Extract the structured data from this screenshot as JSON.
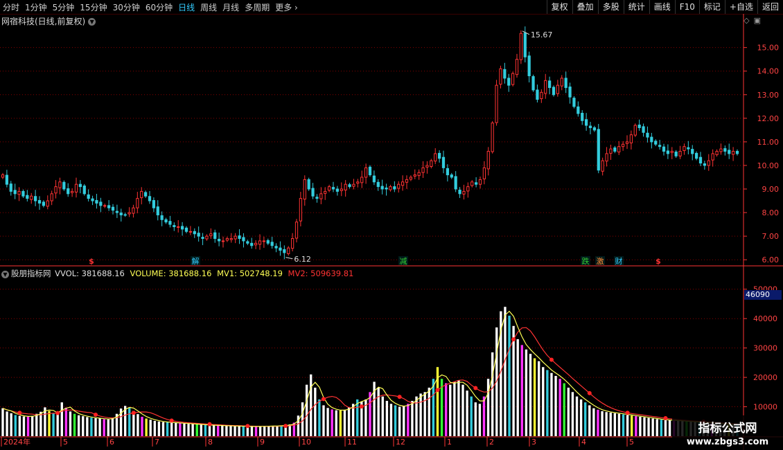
{
  "timeframes": [
    "分时",
    "1分钟",
    "5分钟",
    "15分钟",
    "30分钟",
    "60分钟",
    "日线",
    "周线",
    "月线",
    "多周期",
    "更多"
  ],
  "active_timeframe": "日线",
  "right_buttons": [
    "复权",
    "叠加",
    "多股",
    "统计",
    "画线",
    "F10",
    "标记",
    "+自选",
    "返回"
  ],
  "stock_title": "网宿科技(日线,前复权)",
  "corner_icons": [
    "diamond-icon",
    "window-icon"
  ],
  "indicator": {
    "name": "股朋指标网",
    "vvol": "VVOL: 381688.16",
    "volume": "VOLUME: 381688.16",
    "mv1": "MV1: 502748.19",
    "mv2": "MV2: 509639.81"
  },
  "colors": {
    "up": "#ff3333",
    "down": "#33ccdd",
    "mv1": "#ffff55",
    "mv2": "#ff3333",
    "grid": "#8a0000",
    "axis": "#ff3333"
  },
  "chart_data": [
    {
      "type": "candlestick",
      "price_axis": {
        "ticks": [
          "15.00",
          "14.00",
          "13.00",
          "12.00",
          "11.00",
          "10.00",
          "9.00",
          "8.00",
          "7.00",
          "6.00"
        ],
        "ylim": [
          5.8,
          15.9
        ]
      },
      "annotations": {
        "high": "15.67",
        "low": "6.12"
      },
      "event_markers": [
        "$",
        "解",
        "减",
        "跌",
        "激",
        "财",
        "$"
      ],
      "close_series": [
        9.6,
        9.2,
        8.9,
        8.8,
        8.9,
        8.7,
        8.6,
        8.7,
        8.5,
        8.4,
        8.3,
        8.5,
        8.8,
        9.1,
        9.3,
        9.0,
        8.8,
        8.9,
        9.2,
        9.1,
        8.8,
        8.6,
        8.5,
        8.4,
        8.3,
        8.3,
        8.2,
        8.1,
        8.0,
        7.9,
        7.9,
        8.0,
        8.2,
        8.6,
        8.9,
        8.7,
        8.5,
        8.2,
        7.9,
        7.7,
        7.6,
        7.5,
        7.4,
        7.4,
        7.3,
        7.2,
        7.2,
        7.1,
        7.0,
        6.9,
        7.0,
        7.1,
        6.9,
        6.8,
        6.8,
        6.9,
        6.9,
        7.0,
        6.9,
        6.8,
        6.7,
        6.6,
        6.7,
        6.8,
        6.8,
        6.7,
        6.6,
        6.5,
        6.4,
        6.3,
        6.5,
        6.9,
        7.6,
        8.6,
        9.4,
        9.0,
        8.7,
        8.6,
        8.8,
        8.9,
        9.1,
        9.0,
        8.9,
        9.0,
        9.2,
        9.1,
        9.2,
        9.3,
        9.5,
        9.9,
        9.6,
        9.3,
        9.1,
        9.0,
        9.0,
        9.1,
        9.0,
        9.2,
        9.3,
        9.4,
        9.5,
        9.6,
        9.7,
        9.9,
        10.0,
        10.2,
        10.5,
        10.3,
        9.9,
        9.6,
        9.5,
        9.0,
        8.8,
        8.9,
        9.1,
        9.3,
        9.2,
        9.4,
        9.9,
        10.6,
        11.8,
        13.4,
        14.1,
        13.7,
        13.4,
        13.9,
        14.5,
        15.6,
        14.6,
        13.8,
        13.2,
        12.8,
        13.1,
        13.6,
        13.3,
        13.0,
        13.4,
        13.7,
        13.3,
        12.9,
        12.5,
        12.2,
        11.9,
        11.7,
        11.6,
        11.5,
        9.8,
        10.2,
        10.5,
        10.7,
        10.6,
        10.8,
        10.9,
        11.0,
        11.3,
        11.7,
        11.6,
        11.4,
        11.2,
        11.0,
        10.9,
        10.8,
        10.6,
        10.5,
        10.6,
        10.4,
        10.6,
        10.8,
        10.7,
        10.5,
        10.3,
        10.1,
        10.0,
        10.2,
        10.5,
        10.6,
        10.7,
        10.6,
        10.5,
        10.6,
        10.5
      ]
    },
    {
      "type": "bar",
      "volume_axis": {
        "ticks": [
          "50000",
          "40000",
          "30000",
          "20000",
          "10000"
        ],
        "ylim": [
          0,
          53000
        ]
      },
      "badge": "46090",
      "month_labels": [
        "2024年",
        "5",
        "6",
        "7",
        "8",
        "9",
        "10",
        "11",
        "12",
        "1",
        "2",
        "3",
        "4",
        "5"
      ],
      "volume_series": [
        9500,
        8400,
        7800,
        7200,
        6900,
        6700,
        6600,
        6900,
        7600,
        8300,
        9800,
        8600,
        7800,
        7300,
        11500,
        9700,
        8400,
        7600,
        7100,
        6800,
        6500,
        6300,
        6100,
        6000,
        5800,
        5700,
        6300,
        7600,
        9400,
        10300,
        9700,
        8600,
        7500,
        6600,
        6000,
        5600,
        5200,
        5000,
        4800,
        4700,
        4600,
        4500,
        4400,
        4300,
        4200,
        4100,
        4000,
        3900,
        3800,
        3700,
        3700,
        3600,
        3600,
        3500,
        3500,
        3400,
        3400,
        3300,
        3300,
        3300,
        3300,
        3300,
        3400,
        3400,
        3500,
        3500,
        3600,
        3700,
        4000,
        4600,
        7000,
        11500,
        17500,
        21000,
        16500,
        12500,
        10500,
        9600,
        9100,
        8800,
        8700,
        9000,
        9800,
        11000,
        12500,
        11800,
        12500,
        15000,
        18500,
        16500,
        13500,
        12000,
        11000,
        10500,
        10000,
        10200,
        11000,
        12000,
        13500,
        14500,
        15000,
        16500,
        19500,
        23500,
        19500,
        18000,
        17500,
        18500,
        19000,
        17500,
        15500,
        13500,
        11500,
        11000,
        13500,
        19500,
        28500,
        37000,
        42500,
        44000,
        41000,
        37500,
        33000,
        31000,
        29500,
        28000,
        26500,
        25500,
        23500,
        22500,
        21500,
        20500,
        19500,
        18000,
        16500,
        15000,
        13500,
        12500,
        11500,
        10500,
        9500,
        9000,
        8500,
        8200,
        8000,
        7800,
        7600,
        7400,
        7200,
        7000,
        6800,
        6600,
        6400,
        6200,
        6000,
        5800,
        5600,
        5500,
        5400,
        5300,
        5200,
        5100,
        5000,
        4900,
        4800,
        4700,
        4600,
        4500,
        4400,
        4300,
        4200,
        4100,
        4000,
        3900,
        3800
      ]
    }
  ],
  "watermark": {
    "line1": "指标公式网",
    "line2": "www.zbgs3.com"
  }
}
